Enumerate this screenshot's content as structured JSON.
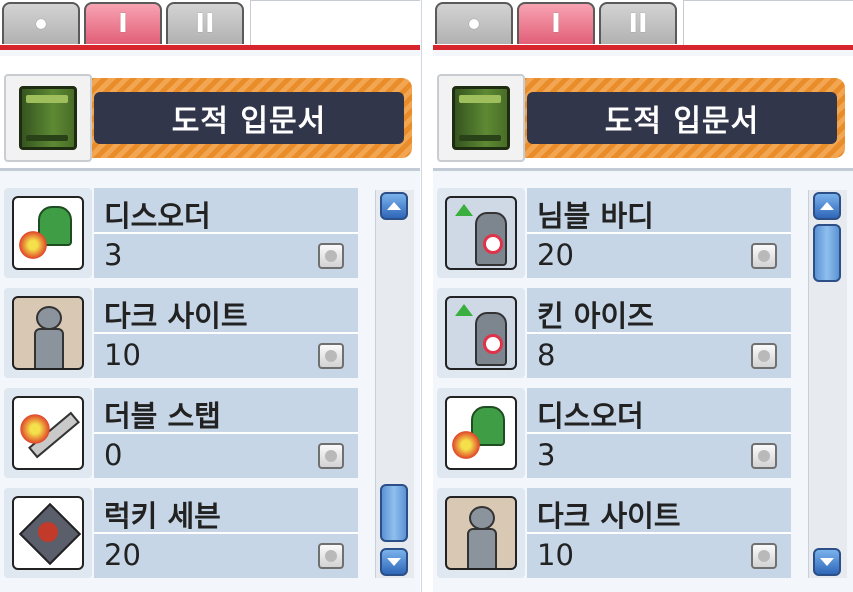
{
  "tabs": [
    {
      "id": "dot",
      "label": ""
    },
    {
      "id": "one",
      "label": "I"
    },
    {
      "id": "two",
      "label": "II"
    }
  ],
  "left_panel": {
    "active_tab": "I",
    "title": "도적 입문서",
    "skills": [
      {
        "name": "디스오더",
        "level": "3",
        "icon": "disorder-icon"
      },
      {
        "name": "다크 사이트",
        "level": "10",
        "icon": "dark-sight-icon"
      },
      {
        "name": "더블 스탭",
        "level": "0",
        "icon": "double-stab-icon"
      },
      {
        "name": "럭키 세븐",
        "level": "20",
        "icon": "lucky-seven-icon"
      }
    ],
    "scroll_position": "bottom"
  },
  "right_panel": {
    "active_tab": "I",
    "title": "도적 입문서",
    "skills": [
      {
        "name": "님블 바디",
        "level": "20",
        "icon": "nimble-body-icon"
      },
      {
        "name": "킨 아이즈",
        "level": "8",
        "icon": "keen-eyes-icon"
      },
      {
        "name": "디스오더",
        "level": "3",
        "icon": "disorder-icon"
      },
      {
        "name": "다크 사이트",
        "level": "10",
        "icon": "dark-sight-icon"
      }
    ],
    "scroll_position": "top"
  },
  "colors": {
    "tab_active": "#e25f78",
    "tab_inactive": "#b1b1b1",
    "accent_strip": "#d6252c",
    "title_bar": "#31364a",
    "title_border": "#e98c2a",
    "row_bg": "#c6d6e7",
    "scroll_button": "#2f67b9"
  }
}
